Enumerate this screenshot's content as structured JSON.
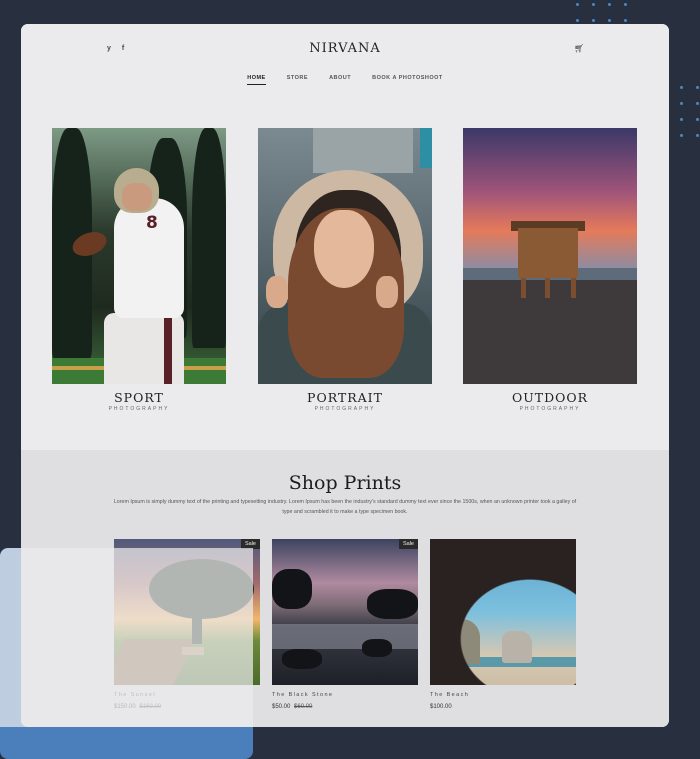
{
  "header": {
    "brand": "NIRVANA",
    "social": [
      {
        "icon": "twitter-icon",
        "glyph": "y"
      },
      {
        "icon": "facebook-icon",
        "glyph": "f"
      }
    ],
    "cart_icon": "cart-icon",
    "nav": [
      {
        "label": "HOME",
        "active": true
      },
      {
        "label": "STORE",
        "active": false
      },
      {
        "label": "ABOUT",
        "active": false
      },
      {
        "label": "BOOK A PHOTOSHOOT",
        "active": false
      }
    ]
  },
  "categories": [
    {
      "title": "SPORT",
      "subtitle": "PHOTOGRAPHY"
    },
    {
      "title": "PORTRAIT",
      "subtitle": "PHOTOGRAPHY"
    },
    {
      "title": "OUTDOOR",
      "subtitle": "PHOTOGRAPHY"
    }
  ],
  "shop": {
    "title": "Shop Prints",
    "description": "Lorem Ipsum is simply dummy text of the printing and typesetting industry. Lorem Ipsum has been the industry's standard dummy text ever since the 1500s, when an unknown printer took a galley of type and scrambled it to make a type specimen book.",
    "products": [
      {
        "name": "The Sunset",
        "price": "$150.00",
        "old_price": "$160.00",
        "badge": "Sale"
      },
      {
        "name": "The Black Stone",
        "price": "$50.00",
        "old_price": "$60.00",
        "badge": "Sale"
      },
      {
        "name": "The Beach",
        "price": "$100.00",
        "old_price": "",
        "badge": ""
      }
    ]
  },
  "colors": {
    "page_background": "#283040",
    "card_background": "#ebebed",
    "shop_background": "#dfdfe1",
    "accent_blue": "#4a7fbc",
    "badge_background": "#2a2a2a"
  }
}
